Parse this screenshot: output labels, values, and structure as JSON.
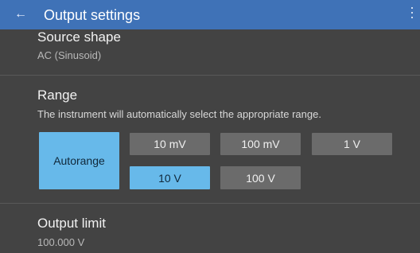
{
  "header": {
    "back_icon": "←",
    "title": "Output settings"
  },
  "source_shape": {
    "title": "Source shape",
    "value": "AC (Sinusoid)"
  },
  "range": {
    "title": "Range",
    "description": "The instrument will automatically select the appropriate range.",
    "autorange_label": "Autorange",
    "options": [
      {
        "label": "10 mV",
        "selected": false
      },
      {
        "label": "100 mV",
        "selected": false
      },
      {
        "label": "1 V",
        "selected": false
      },
      {
        "label": "10 V",
        "selected": true
      },
      {
        "label": "100 V",
        "selected": false
      }
    ]
  },
  "output_limit": {
    "title": "Output limit",
    "value": "100.000 V"
  },
  "colors": {
    "header_bg": "#3f72b7",
    "page_bg": "#434343",
    "accent": "#67b9ea",
    "button_bg": "#6b6b6b"
  }
}
